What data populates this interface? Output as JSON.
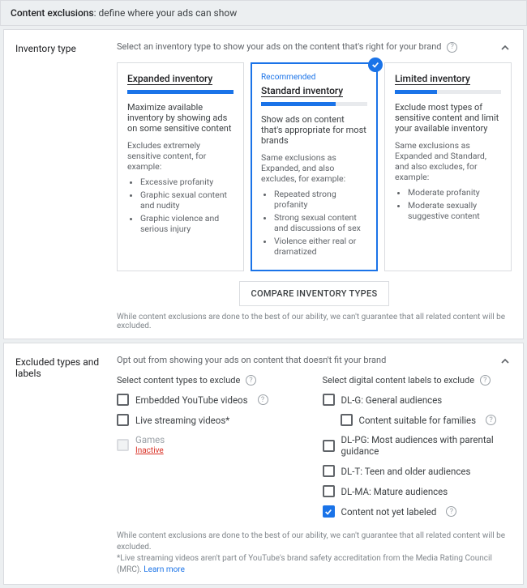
{
  "header": {
    "title": "Content exclusions",
    "subtitle": ": define where your ads can show"
  },
  "inventory": {
    "label": "Inventory type",
    "subtitle": "Select an inventory type to show your ads on the content that's right for your brand",
    "cards": [
      {
        "recommended": "",
        "title": "Expanded inventory",
        "meterPct": "100%",
        "desc": "Maximize available inventory by showing ads on some sensitive content",
        "sub": "Excludes extremely sensitive content, for example:",
        "bullets": [
          "Excessive profanity",
          "Graphic sexual content and nudity",
          "Graphic violence and serious injury"
        ]
      },
      {
        "recommended": "Recommended",
        "title": "Standard inventory",
        "meterPct": "70%",
        "desc": "Show ads on content that's appropriate for most brands",
        "sub": "Same exclusions as Expanded, and also excludes, for example:",
        "bullets": [
          "Repeated strong profanity",
          "Strong sexual content and discussions of sex",
          "Violence either real or dramatized"
        ]
      },
      {
        "recommended": "",
        "title": "Limited inventory",
        "meterPct": "40%",
        "desc": "Exclude most types of sensitive content and limit your available inventory",
        "sub": "Same exclusions as Expanded and Standard, and also excludes, for example:",
        "bullets": [
          "Moderate profanity",
          "Moderate sexually suggestive content"
        ]
      }
    ],
    "compare": "COMPARE INVENTORY TYPES",
    "disclaimer": "While content exclusions are done to the best of our ability, we can't guarantee that all related content will be excluded."
  },
  "excluded": {
    "label": "Excluded types and labels",
    "subtitle": "Opt out from showing your ads on content that doesn't fit your brand",
    "leftHeading": "Select content types to exclude",
    "rightHeading": "Select digital content labels to exclude",
    "leftItems": [
      {
        "label": "Embedded YouTube videos",
        "help": true,
        "state": "unchecked"
      },
      {
        "label": "Live streaming videos",
        "asterisk": "*",
        "state": "unchecked"
      },
      {
        "label": "Games",
        "sub": "Inactive",
        "state": "disabled"
      }
    ],
    "rightItems": [
      {
        "label": "DL-G: General audiences",
        "state": "unchecked"
      },
      {
        "label": "Content suitable for families",
        "help": true,
        "indent": true,
        "state": "unchecked"
      },
      {
        "label": "DL-PG: Most audiences with parental guidance",
        "state": "unchecked"
      },
      {
        "label": "DL-T: Teen and older audiences",
        "state": "unchecked"
      },
      {
        "label": "DL-MA: Mature audiences",
        "state": "unchecked"
      },
      {
        "label": "Content not yet labeled",
        "help": true,
        "state": "checked"
      }
    ],
    "footer1": "While content exclusions are done to the best of our ability, we can't guarantee that all related content will be excluded.",
    "footer2": "*Live streaming videos aren't part of YouTube's brand safety accreditation from the Media Rating Council (MRC). ",
    "learnMore": "Learn more"
  }
}
